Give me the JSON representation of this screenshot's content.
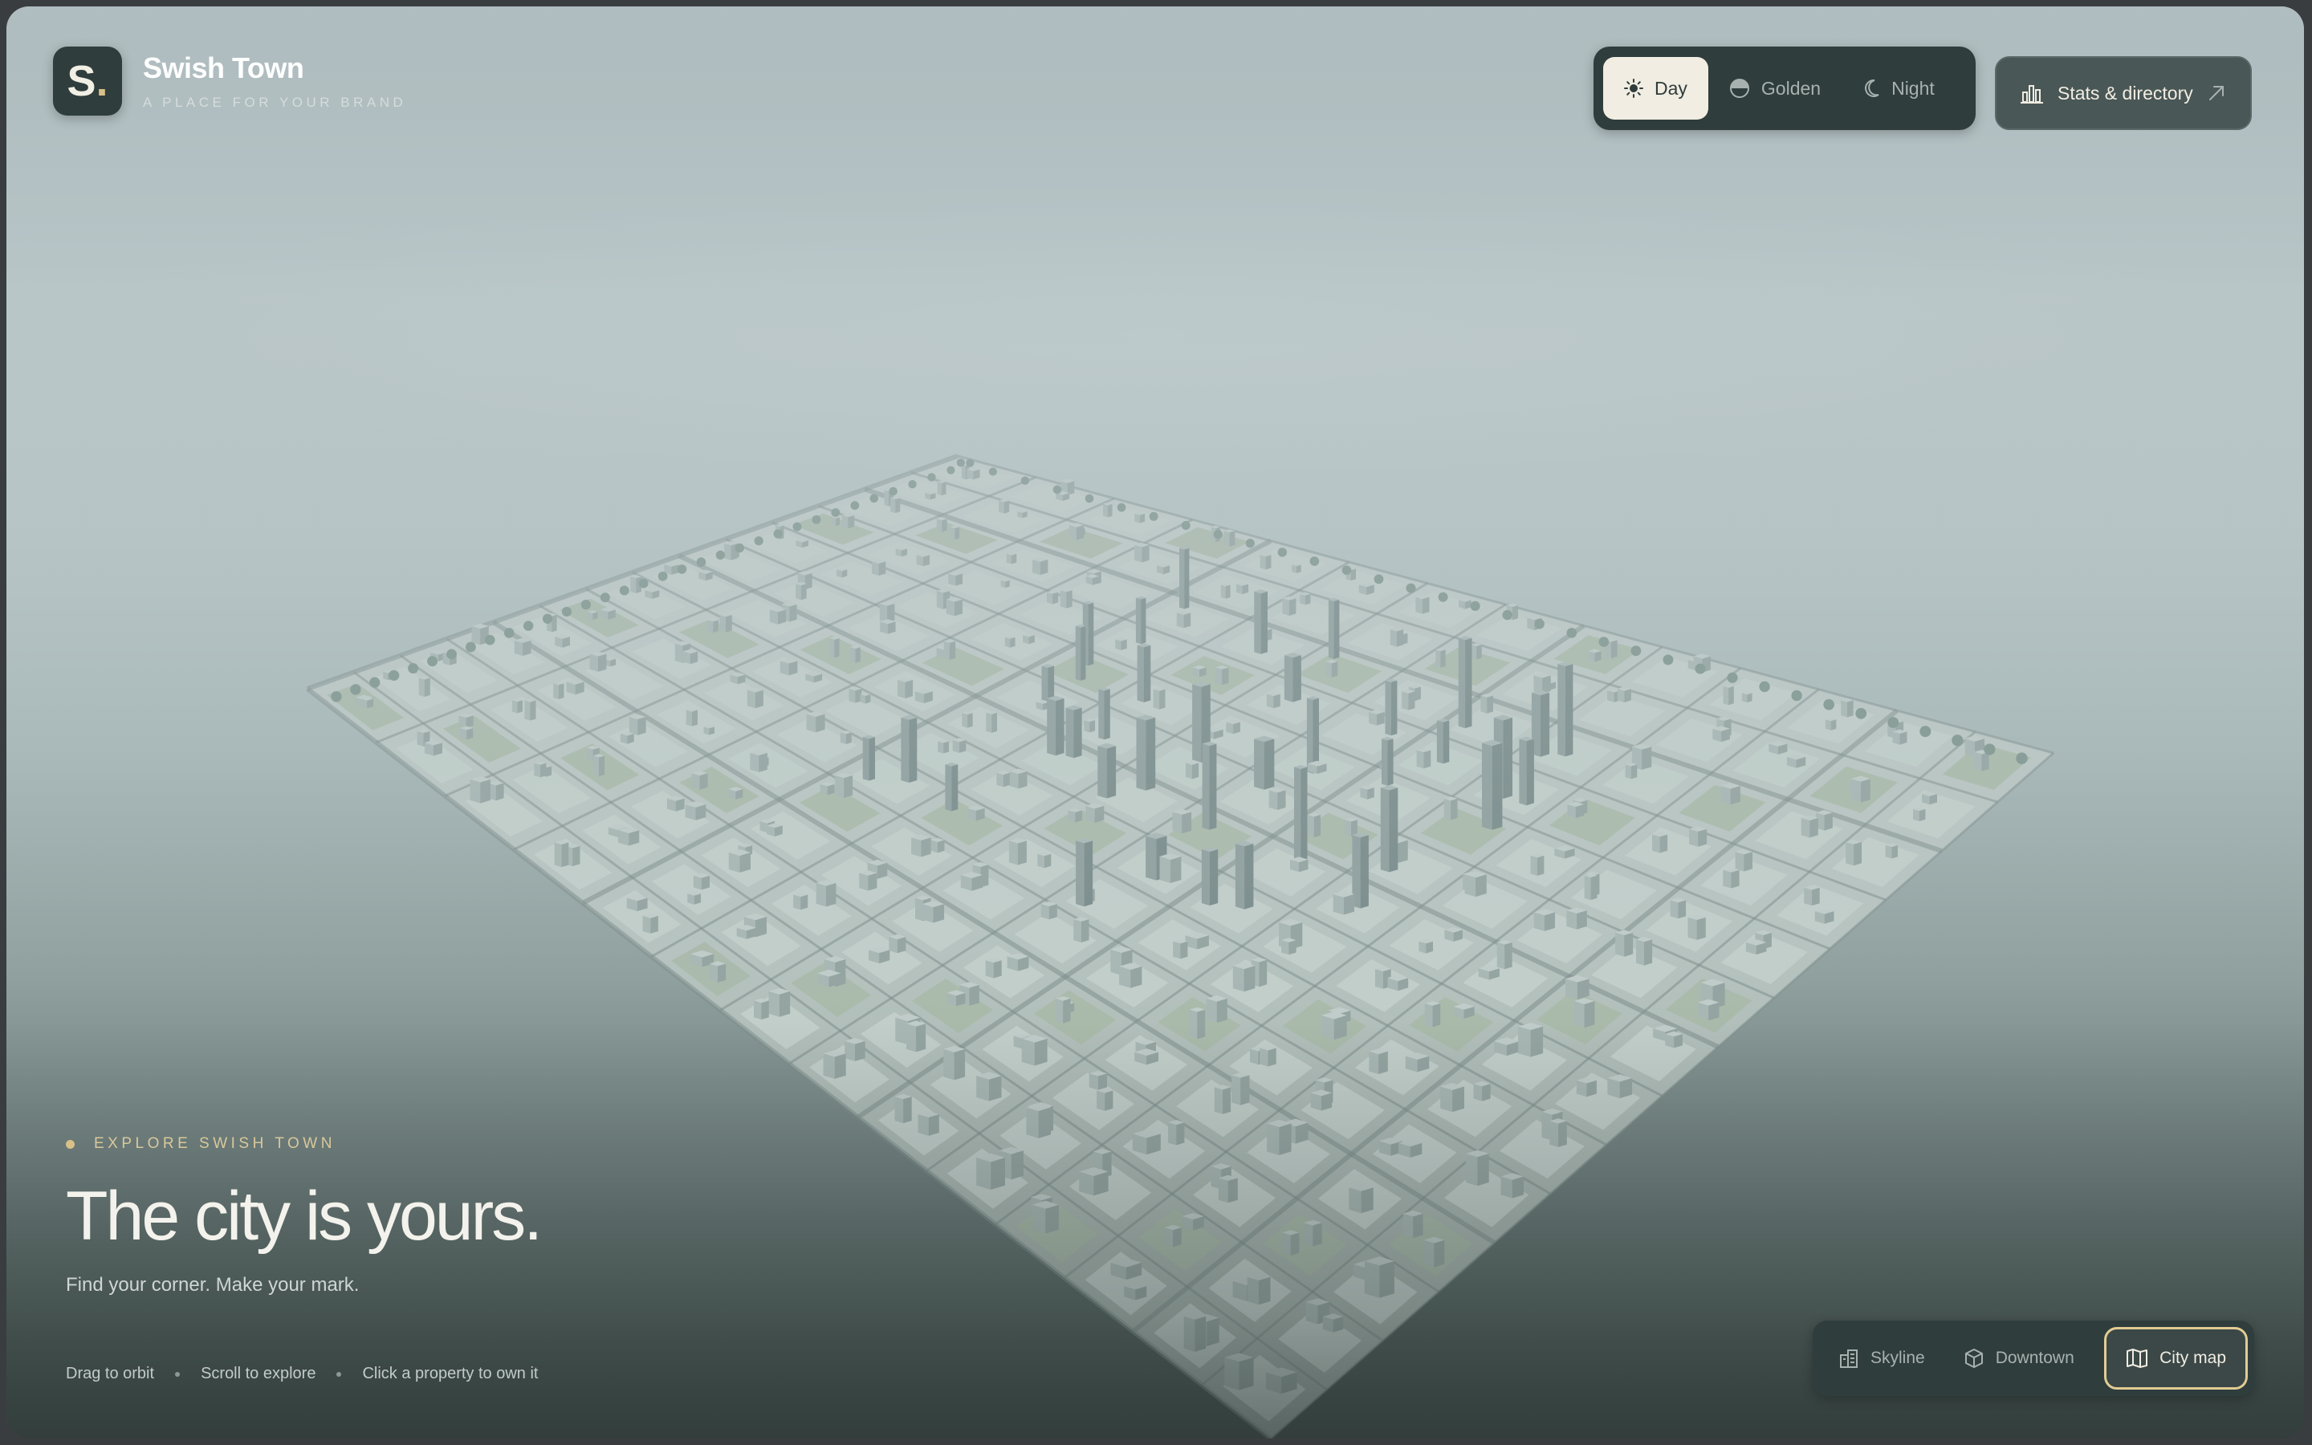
{
  "brand": {
    "logo_letter": "S",
    "logo_dot": ".",
    "title": "Swish Town",
    "subtitle": "A PLACE FOR YOUR BRAND"
  },
  "lighting": {
    "options": [
      {
        "label": "Day",
        "icon": "sun-icon",
        "active": true
      },
      {
        "label": "Golden",
        "icon": "half-circle-icon",
        "active": false
      },
      {
        "label": "Night",
        "icon": "moon-icon",
        "active": false
      }
    ]
  },
  "stats_button": {
    "label": "Stats & directory",
    "icon": "bar-chart-icon",
    "trailing_icon": "arrow-up-right-icon"
  },
  "hero": {
    "eyebrow": "EXPLORE SWISH TOWN",
    "headline": "The city is yours.",
    "tagline": "Find your corner. Make your mark."
  },
  "hints": [
    "Drag to orbit",
    "Scroll to explore",
    "Click a property to own it"
  ],
  "views": {
    "options": [
      {
        "label": "Skyline",
        "icon": "buildings-icon",
        "active": false
      },
      {
        "label": "Downtown",
        "icon": "cube-icon",
        "active": false
      },
      {
        "label": "City map",
        "icon": "map-icon",
        "active": true
      }
    ]
  },
  "colors": {
    "accent": "#e2cc93",
    "panel": "#2f3d3c",
    "active_chip": "#f1ede2"
  }
}
